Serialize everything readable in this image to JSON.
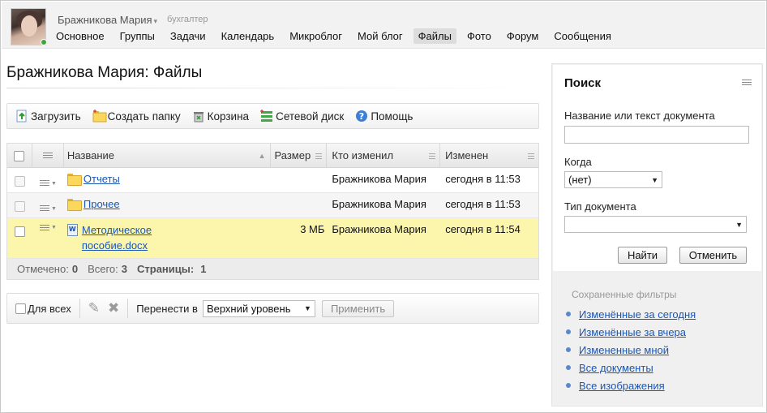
{
  "header": {
    "user_name": "Бражникова Мария",
    "user_role": "бухгалтер",
    "nav": [
      "Основное",
      "Группы",
      "Задачи",
      "Календарь",
      "Микроблог",
      "Мой блог",
      "Файлы",
      "Фото",
      "Форум",
      "Сообщения"
    ],
    "active_nav": "Файлы"
  },
  "page": {
    "title": "Бражникова Мария: Файлы"
  },
  "toolbar": {
    "upload": "Загрузить",
    "create_folder": "Создать папку",
    "trash": "Корзина",
    "network_drive": "Сетевой диск",
    "help": "Помощь"
  },
  "table": {
    "columns": {
      "name": "Название",
      "size": "Размер",
      "modified_by": "Кто изменил",
      "modified": "Изменен"
    },
    "rows": [
      {
        "type": "folder",
        "name": "Отчеты",
        "size": "",
        "modified_by": "Бражникова Мария",
        "modified": "сегодня в 11:53"
      },
      {
        "type": "folder",
        "name": "Прочее",
        "size": "",
        "modified_by": "Бражникова Мария",
        "modified": "сегодня в 11:53"
      },
      {
        "type": "document",
        "name": "Методическое пособие.docx",
        "size": "3 МБ",
        "modified_by": "Бражникова Мария",
        "modified": "сегодня в 11:54"
      }
    ],
    "footer": {
      "checked_label": "Отмечено:",
      "checked": "0",
      "total_label": "Всего:",
      "total": "3",
      "pages_label": "Страницы:",
      "pages": "1"
    }
  },
  "actions": {
    "for_all": "Для всех",
    "move_to_label": "Перенести в",
    "move_to_value": "Верхний уровень",
    "apply": "Применить"
  },
  "search": {
    "title": "Поиск",
    "name_label": "Название или текст документа",
    "name_value": "",
    "when_label": "Когда",
    "when_value": "(нет)",
    "doc_type_label": "Тип документа",
    "doc_type_value": "",
    "find": "Найти",
    "cancel": "Отменить",
    "saved_filters_title": "Сохраненные фильтры",
    "saved_filters": [
      "Изменённые за сегодня",
      "Изменённые за вчера",
      "Измененные мной",
      "Все документы",
      "Все изображения"
    ]
  },
  "colors": {
    "link": "#1a56b4",
    "selected_row": "#fbf6ac",
    "online": "#3fa43a"
  }
}
